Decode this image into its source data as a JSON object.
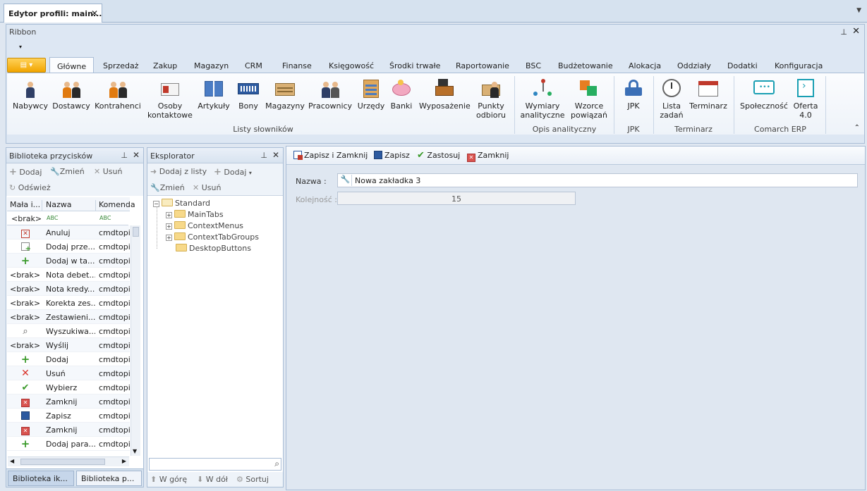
{
  "document_tab": {
    "title": "Edytor profili: main...",
    "close": "✕"
  },
  "ribbon": {
    "title": "Ribbon",
    "qat_glyph": "▾",
    "tabs": [
      "Główne",
      "Sprzedaż",
      "Zakup",
      "Magazyn",
      "CRM",
      "Finanse",
      "Księgowość",
      "Środki trwałe",
      "Raportowanie",
      "BSC",
      "Budżetowanie",
      "Alokacja",
      "Oddziały",
      "Dodatki",
      "Konfiguracja"
    ],
    "groups": [
      {
        "label": "Listy słowników",
        "buttons": [
          {
            "label": "Nabywcy"
          },
          {
            "label": "Dostawcy"
          },
          {
            "label": "Kontrahenci"
          },
          {
            "label": "Osoby kontaktowe"
          },
          {
            "label": "Artykuły"
          },
          {
            "label": "Bony"
          },
          {
            "label": "Magazyny"
          },
          {
            "label": "Pracownicy"
          },
          {
            "label": "Urzędy"
          },
          {
            "label": "Banki"
          },
          {
            "label": "Wyposażenie"
          },
          {
            "label": "Punkty odbioru"
          }
        ]
      },
      {
        "label": "Opis analityczny",
        "buttons": [
          {
            "label": "Wymiary analityczne"
          },
          {
            "label": "Wzorce powiązań"
          }
        ]
      },
      {
        "label": "JPK",
        "buttons": [
          {
            "label": "JPK"
          }
        ]
      },
      {
        "label": "Terminarz",
        "buttons": [
          {
            "label": "Lista zadań"
          },
          {
            "label": "Terminarz"
          }
        ]
      },
      {
        "label": "Comarch ERP",
        "buttons": [
          {
            "label": "Społeczność"
          },
          {
            "label": "Oferta 4.0"
          }
        ]
      }
    ]
  },
  "library": {
    "title": "Biblioteka przycisków",
    "toolbar": {
      "add": "Dodaj",
      "edit": "Zmień",
      "delete": "Usuń",
      "refresh": "Odśwież"
    },
    "columns": [
      "Mała i...",
      "Nazwa",
      "Komenda"
    ],
    "filter": {
      "c1": "<brak>",
      "c2": "ABC",
      "c3": "ABC"
    },
    "rows": [
      {
        "icon": "cancel-icon",
        "c1": "",
        "name": "Anuluj",
        "cmd": "cmdtopic"
      },
      {
        "icon": "add-item-icon",
        "c1": "",
        "name": "Dodaj prze...",
        "cmd": "cmdtopic"
      },
      {
        "icon": "plus-icon",
        "c1": "",
        "name": "Dodaj w ta...",
        "cmd": "cmdtopic"
      },
      {
        "icon": "",
        "c1": "<brak>",
        "name": "Nota debet...",
        "cmd": "cmdtopic"
      },
      {
        "icon": "",
        "c1": "<brak>",
        "name": "Nota kredy...",
        "cmd": "cmdtopic"
      },
      {
        "icon": "",
        "c1": "<brak>",
        "name": "Korekta zes...",
        "cmd": "cmdtopic"
      },
      {
        "icon": "",
        "c1": "<brak>",
        "name": "Zestawieni...",
        "cmd": "cmdtopic"
      },
      {
        "icon": "search-icon",
        "c1": "",
        "name": "Wyszukiwa...",
        "cmd": "cmdtopic"
      },
      {
        "icon": "",
        "c1": "<brak>",
        "name": "Wyślij",
        "cmd": "cmdtopic"
      },
      {
        "icon": "plus-icon",
        "c1": "",
        "name": "Dodaj",
        "cmd": "cmdtopic"
      },
      {
        "icon": "delete-x-icon",
        "c1": "",
        "name": "Usuń",
        "cmd": "cmdtopic"
      },
      {
        "icon": "check-icon",
        "c1": "",
        "name": "Wybierz",
        "cmd": "cmdtopic"
      },
      {
        "icon": "close-red-icon",
        "c1": "",
        "name": "Zamknij",
        "cmd": "cmdtopic"
      },
      {
        "icon": "save-icon",
        "c1": "",
        "name": "Zapisz",
        "cmd": "cmdtopic"
      },
      {
        "icon": "close-red-icon",
        "c1": "",
        "name": "Zamknij",
        "cmd": "cmdtopic"
      },
      {
        "icon": "plus-icon",
        "c1": "",
        "name": "Dodaj para...",
        "cmd": "cmdtopic"
      }
    ],
    "bottom_tabs": [
      "Biblioteka ik...",
      "Biblioteka p..."
    ]
  },
  "explorer": {
    "title": "Eksplorator",
    "toolbar": {
      "add_from_list": "Dodaj z listy",
      "add": "Dodaj",
      "edit": "Zmień",
      "delete": "Usuń"
    },
    "tree": {
      "root": "Standard",
      "children": [
        "MainTabs",
        "ContextMenus",
        "ContextTabGroups",
        "DesktopButtons"
      ]
    },
    "search_value": "",
    "footer": {
      "up": "W górę",
      "down": "W dół",
      "sort": "Sortuj"
    }
  },
  "form": {
    "toolbar": {
      "save_close": "Zapisz i Zamknij",
      "save": "Zapisz",
      "apply": "Zastosuj",
      "close": "Zamknij"
    },
    "name_label": "Nazwa :",
    "name_value": "Nowa zakładka 3",
    "order_label": "Kolejność :",
    "order_value": "15"
  }
}
